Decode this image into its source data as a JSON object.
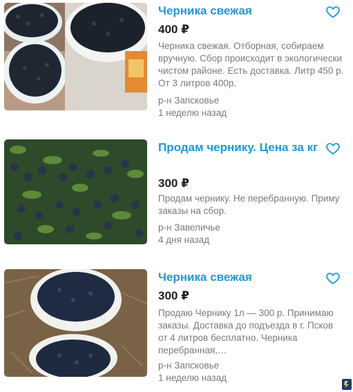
{
  "listings": [
    {
      "title": "Черника свежая",
      "price": "400 ₽",
      "description": "Черника свежая. Отборная, собираем вручную. Сбор происходит в экологически чистом районе. Есть доставка. Литр 450 р. От 3 литров 400р.",
      "location": "р-н Запсковье",
      "time": "1 неделю назад"
    },
    {
      "title": "Продам чернику. Цена за кг",
      "price": "300 ₽",
      "description": "Продам чернику. Не перебранную. Приму заказы на сбор.",
      "location": "р-н Завеличье",
      "time": "4 дня назад"
    },
    {
      "title": "Черника свежая",
      "price": "300 ₽",
      "description": "Продаю Чернику 1л — 300 р. Принимаю заказы. Доставка до подъезда в г. Псков от 4 литров бесплатно. Черника перебранная,…",
      "location": "р-н Запсковье",
      "time": "1 неделю назад"
    }
  ],
  "colors": {
    "title": "#1a9bd7",
    "favorite_icon": "#1a9bd7",
    "muted_text": "#7a7a7a"
  },
  "icons": {
    "favorite": "heart-outline-icon",
    "corner": "app-badge-icon"
  }
}
